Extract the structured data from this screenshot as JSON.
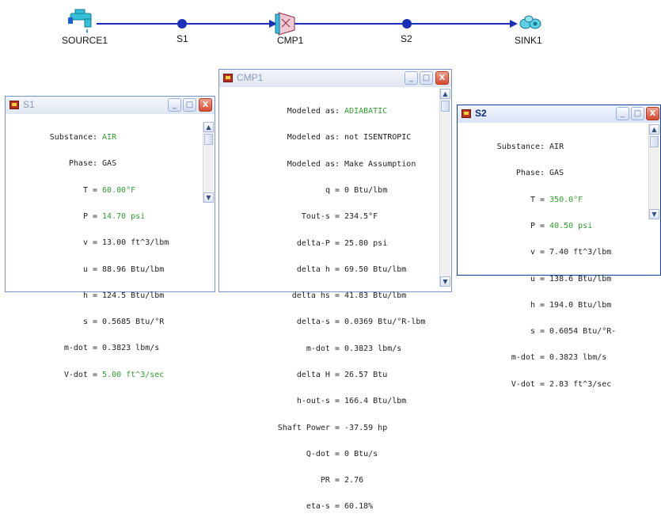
{
  "diagram": {
    "nodes": [
      {
        "label": "SOURCE1",
        "icon": "faucet-icon"
      },
      {
        "label": "S1",
        "icon": "state-point-icon"
      },
      {
        "label": "CMP1",
        "icon": "compressor-icon"
      },
      {
        "label": "S2",
        "icon": "state-point-icon"
      },
      {
        "label": "SINK1",
        "icon": "sink-coil-icon"
      }
    ],
    "line_color": "#1c2fb8"
  },
  "windows": {
    "s1": {
      "title": "S1",
      "rows": [
        {
          "label": "Substance:",
          "value": "AIR",
          "highlight": true
        },
        {
          "label": "Phase:",
          "value": "GAS",
          "highlight": false
        },
        {
          "label": "T =",
          "value": "60.00°F",
          "highlight": true
        },
        {
          "label": "P =",
          "value": "14.70 psi",
          "highlight": true
        },
        {
          "label": "v =",
          "value": "13.00 ft^3/lbm",
          "highlight": false
        },
        {
          "label": "u =",
          "value": "88.96 Btu/lbm",
          "highlight": false
        },
        {
          "label": "h =",
          "value": "124.5 Btu/lbm",
          "highlight": false
        },
        {
          "label": "s =",
          "value": "0.5685 Btu/°R",
          "highlight": false
        },
        {
          "label": "m-dot =",
          "value": "0.3823 lbm/s",
          "highlight": false
        },
        {
          "label": "V-dot =",
          "value": "5.00 ft^3/sec",
          "highlight": true
        }
      ]
    },
    "cmp1": {
      "title": "CMP1",
      "rows": [
        {
          "label": "Modeled as:",
          "value": "ADIABATIC",
          "highlight": true
        },
        {
          "label": "Modeled as:",
          "value": "not ISENTROPIC",
          "highlight": false
        },
        {
          "label": "Modeled as:",
          "value": "Make Assumption",
          "highlight": false
        },
        {
          "label": "q =",
          "value": "0 Btu/lbm",
          "highlight": false
        },
        {
          "label": "Tout-s =",
          "value": "234.5°F",
          "highlight": false
        },
        {
          "label": "delta-P =",
          "value": "25.80 psi",
          "highlight": false
        },
        {
          "label": "delta h =",
          "value": "69.50 Btu/lbm",
          "highlight": false
        },
        {
          "label": "delta hs =",
          "value": "41.83 Btu/lbm",
          "highlight": false
        },
        {
          "label": "delta-s =",
          "value": "0.0369 Btu/°R-lbm",
          "highlight": false
        },
        {
          "label": "m-dot =",
          "value": "0.3823 lbm/s",
          "highlight": false
        },
        {
          "label": "delta H =",
          "value": "26.57 Btu",
          "highlight": false
        },
        {
          "label": "h-out-s =",
          "value": "166.4 Btu/lbm",
          "highlight": false
        },
        {
          "label": "Shaft Power =",
          "value": "-37.59 hp",
          "highlight": false
        },
        {
          "label": "Q-dot =",
          "value": "0 Btu/s",
          "highlight": false
        },
        {
          "label": "PR =",
          "value": "2.76",
          "highlight": false
        },
        {
          "label": "eta-s =",
          "value": "60.18%",
          "highlight": false
        }
      ]
    },
    "s2": {
      "title": "S2",
      "rows": [
        {
          "label": "Substance:",
          "value": "AIR",
          "highlight": false
        },
        {
          "label": "Phase:",
          "value": "GAS",
          "highlight": false
        },
        {
          "label": "T =",
          "value": "350.0°F",
          "highlight": true
        },
        {
          "label": "P =",
          "value": "40.50 psi",
          "highlight": true
        },
        {
          "label": "v =",
          "value": "7.40 ft^3/lbm",
          "highlight": false
        },
        {
          "label": "u =",
          "value": "138.6 Btu/lbm",
          "highlight": false
        },
        {
          "label": "h =",
          "value": "194.0 Btu/lbm",
          "highlight": false
        },
        {
          "label": "s =",
          "value": "0.6054 Btu/°R-",
          "highlight": false
        },
        {
          "label": "m-dot =",
          "value": "0.3823 lbm/s",
          "highlight": false
        },
        {
          "label": "V-dot =",
          "value": "2.83 ft^3/sec",
          "highlight": false
        }
      ]
    }
  },
  "window_buttons": {
    "minimize": "_",
    "maximize": "□",
    "close": "X"
  },
  "scroll_buttons": {
    "up": "▲",
    "down": "▼"
  },
  "colors": {
    "highlight_value": "#2f9e2f",
    "close_button": "#d64a2f",
    "active_title": "#0b2c7a"
  }
}
